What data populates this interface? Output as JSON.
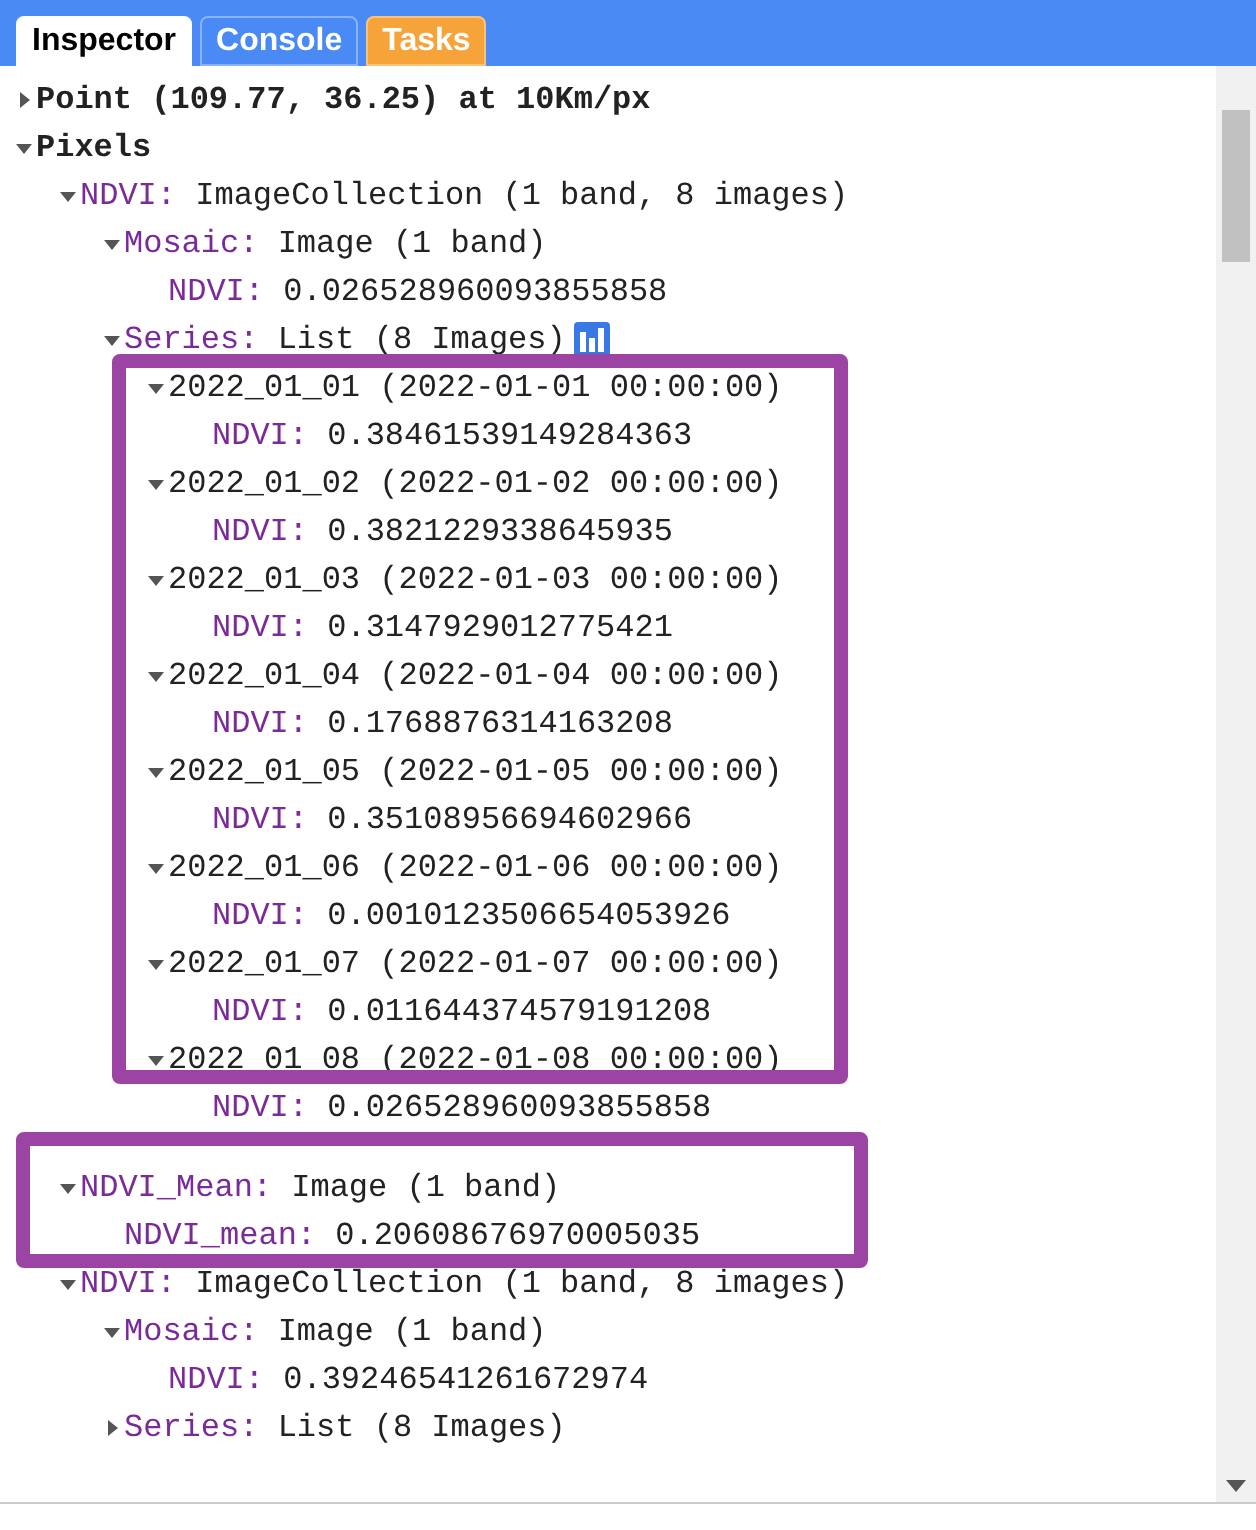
{
  "tabs": [
    {
      "label": "Inspector",
      "selected": true,
      "color": "#ffffff"
    },
    {
      "label": "Console",
      "selected": false,
      "color": "#4a8af4"
    },
    {
      "label": "Tasks",
      "selected": false,
      "color": "#f6a43a"
    }
  ],
  "tree": [
    {
      "label": "Point (109.77, 36.25) at 10Km/px",
      "expanded": false
    },
    {
      "label": "Pixels",
      "expanded": true,
      "children": [
        {
          "key": "NDVI:",
          "value": "ImageCollection (1 band, 8 images)",
          "expanded": true,
          "children": [
            {
              "key": "Mosaic:",
              "value": "Image (1 band)",
              "expanded": true,
              "children": [
                {
                  "key": "NDVI:",
                  "value": "0.026528960093855858"
                }
              ]
            },
            {
              "key": "Series:",
              "value": "List (8 Images)",
              "expanded": true,
              "chart_icon": true,
              "highlight_children": true,
              "children": [
                {
                  "value": "2022_01_01 (2022-01-01 00:00:00)",
                  "expanded": true,
                  "children": [
                    {
                      "key": "NDVI:",
                      "value": "0.38461539149284363"
                    }
                  ]
                },
                {
                  "value": "2022_01_02 (2022-01-02 00:00:00)",
                  "expanded": true,
                  "children": [
                    {
                      "key": "NDVI:",
                      "value": "0.3821229338645935"
                    }
                  ]
                },
                {
                  "value": "2022_01_03 (2022-01-03 00:00:00)",
                  "expanded": true,
                  "children": [
                    {
                      "key": "NDVI:",
                      "value": "0.3147929012775421"
                    }
                  ]
                },
                {
                  "value": "2022_01_04 (2022-01-04 00:00:00)",
                  "expanded": true,
                  "children": [
                    {
                      "key": "NDVI:",
                      "value": "0.1768876314163208"
                    }
                  ]
                },
                {
                  "value": "2022_01_05 (2022-01-05 00:00:00)",
                  "expanded": true,
                  "children": [
                    {
                      "key": "NDVI:",
                      "value": "0.35108956694602966"
                    }
                  ]
                },
                {
                  "value": "2022_01_06 (2022-01-06 00:00:00)",
                  "expanded": true,
                  "children": [
                    {
                      "key": "NDVI:",
                      "value": "0.0010123506654053926"
                    }
                  ]
                },
                {
                  "value": "2022_01_07 (2022-01-07 00:00:00)",
                  "expanded": true,
                  "children": [
                    {
                      "key": "NDVI:",
                      "value": "0.011644374579191208"
                    }
                  ]
                },
                {
                  "value": "2022_01_08 (2022-01-08 00:00:00)",
                  "expanded": true,
                  "children": [
                    {
                      "key": "NDVI:",
                      "value": "0.026528960093855858"
                    }
                  ]
                }
              ]
            }
          ]
        },
        {
          "key": "NDVI_Mean:",
          "value": "Image (1 band)",
          "expanded": true,
          "highlight": true,
          "children": [
            {
              "key": "NDVI_mean:",
              "value": "0.20608676970005035"
            }
          ]
        },
        {
          "key": "NDVI:",
          "value": "ImageCollection (1 band, 8 images)",
          "expanded": true,
          "children": [
            {
              "key": "Mosaic:",
              "value": "Image (1 band)",
              "expanded": true,
              "children": [
                {
                  "key": "NDVI:",
                  "value": "0.39246541261672974"
                }
              ]
            },
            {
              "key": "Series:",
              "value": "List (8 Images)",
              "expanded": false
            }
          ]
        }
      ]
    }
  ]
}
